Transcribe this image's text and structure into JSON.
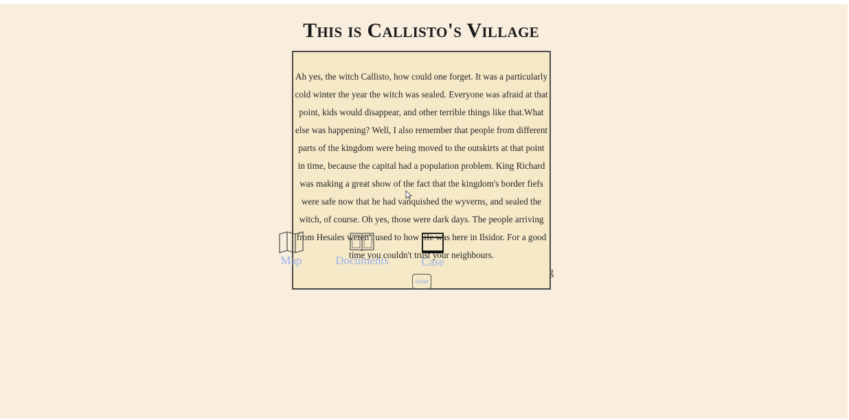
{
  "page": {
    "title": "This is Callisto's Village"
  },
  "dialog": {
    "text": "Ah yes, the witch Callisto, how could one forget. It was a particularly cold winter the year the witch was sealed. Everyone was afraid at that point, kids would disappear, and other terrible things like that.What else was happening? Well, I also remember that people from different parts of the kingdom were being moved to the outskirts at that point in time, because the capital had a population problem. King Richard was making a great show of the fact that the kingdom's border fiefs were safe now that he had vanquished the wyverns, and sealed the witch, of course. Oh yes, those were dark days. The people arriving from Hesales weren't used to how life was here in Ilsidor. For a good time you couldn't trust your neighbours.",
    "close_label": "close"
  },
  "nav": {
    "items": [
      {
        "label": "Map",
        "icon": "map-icon"
      },
      {
        "label": "Documents",
        "icon": "book-icon"
      },
      {
        "label": "Case",
        "icon": "case-icon"
      }
    ]
  },
  "background_fragment": "g",
  "colors": {
    "background": "#f9eedd",
    "dialog_bg": "#f5e9c8",
    "nav_label": "#93aef0",
    "border": "#4a4a4a"
  }
}
